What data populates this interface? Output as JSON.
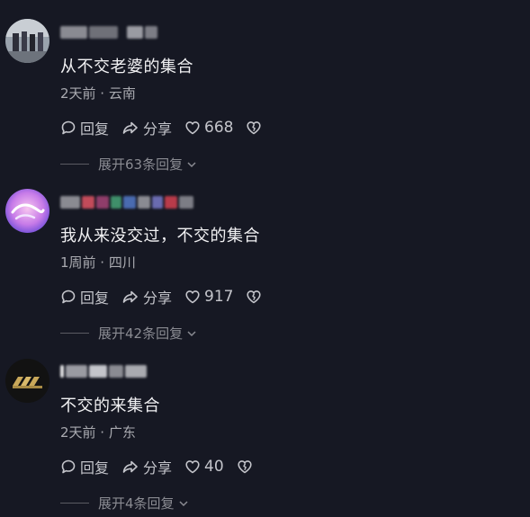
{
  "comments": [
    {
      "text": "从不交老婆的集合",
      "meta": "2天前 · 云南",
      "reply_label": "回复",
      "share_label": "分享",
      "likes": "668",
      "expand_label": "展开63条回复"
    },
    {
      "text": "我从来没交过，不交的集合",
      "meta": "1周前 · 四川",
      "reply_label": "回复",
      "share_label": "分享",
      "likes": "917",
      "expand_label": "展开42条回复"
    },
    {
      "text": "不交的来集合",
      "meta": "2天前 · 广东",
      "reply_label": "回复",
      "share_label": "分享",
      "likes": "40",
      "expand_label": "展开4条回复"
    }
  ],
  "icons": {
    "reply": "speech-bubble-icon",
    "share": "share-arrow-icon",
    "like": "heart-icon",
    "dislike": "broken-heart-icon",
    "expand": "chevron-down-icon"
  },
  "colors": {
    "background": "#161823",
    "text": "#f1f1f3",
    "meta": "#a9aab0",
    "muted": "#8a8b92"
  }
}
